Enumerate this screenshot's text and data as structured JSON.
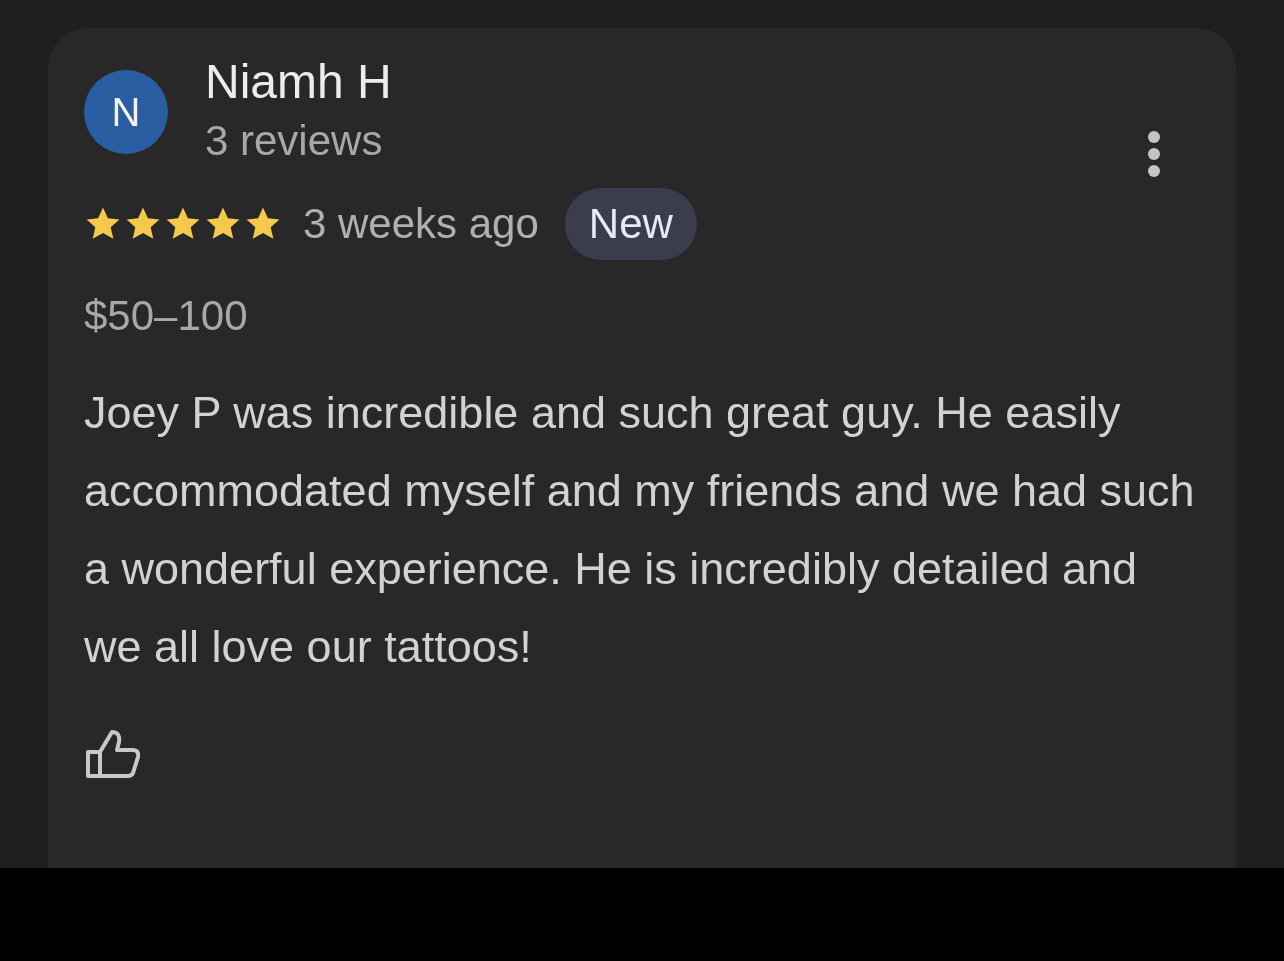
{
  "review": {
    "avatar_letter": "N",
    "author": "Niamh H",
    "review_count": "3 reviews",
    "stars": 5,
    "time": "3 weeks ago",
    "badge": "New",
    "price": "$50–100",
    "text": "Joey P was incredible and such great guy. He easily accommodated myself and my friends and we had such a wonderful experience. He is incredibly detailed and we all love our tattoos!"
  }
}
